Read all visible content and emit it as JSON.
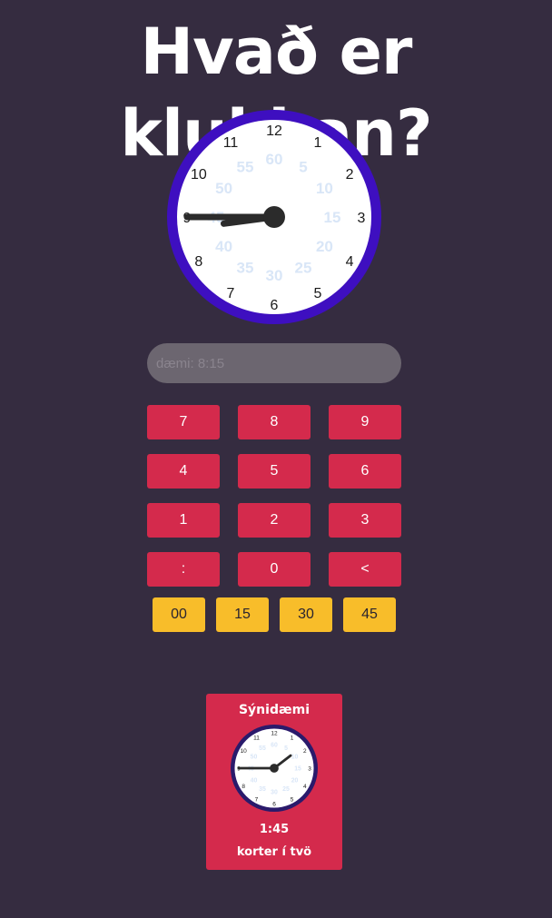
{
  "page": {
    "title": "Hvað er klukkan?"
  },
  "colors": {
    "background": "#352c40",
    "clock_rim_main": "#3e0fc0",
    "clock_rim_example": "#2a1a6b",
    "clock_face": "#ffffff",
    "minute_numbers": "#d9e6f7",
    "hands": "#2b2b2b",
    "key_red": "#d42a4c",
    "key_yellow": "#f8bd2a",
    "input_bg": "#6c6670"
  },
  "main_clock": {
    "hour_numbers": [
      "12",
      "1",
      "2",
      "3",
      "4",
      "5",
      "6",
      "7",
      "8",
      "9",
      "10",
      "11"
    ],
    "minute_numbers": [
      "60",
      "5",
      "10",
      "15",
      "20",
      "25",
      "30",
      "35",
      "40",
      "45",
      "50",
      "55"
    ],
    "time": {
      "hour": 8,
      "minute": 45
    }
  },
  "input": {
    "value": "",
    "placeholder": "dæmi: 8:15"
  },
  "keypad": {
    "keys": [
      "7",
      "8",
      "9",
      "4",
      "5",
      "6",
      "1",
      "2",
      "3",
      ":",
      "0",
      "<"
    ]
  },
  "quick_minutes": [
    "00",
    "15",
    "30",
    "45"
  ],
  "example": {
    "title": "Sýnidæmi",
    "time_text": "1:45",
    "words": "korter í tvö",
    "time": {
      "hour": 1,
      "minute": 45
    }
  }
}
